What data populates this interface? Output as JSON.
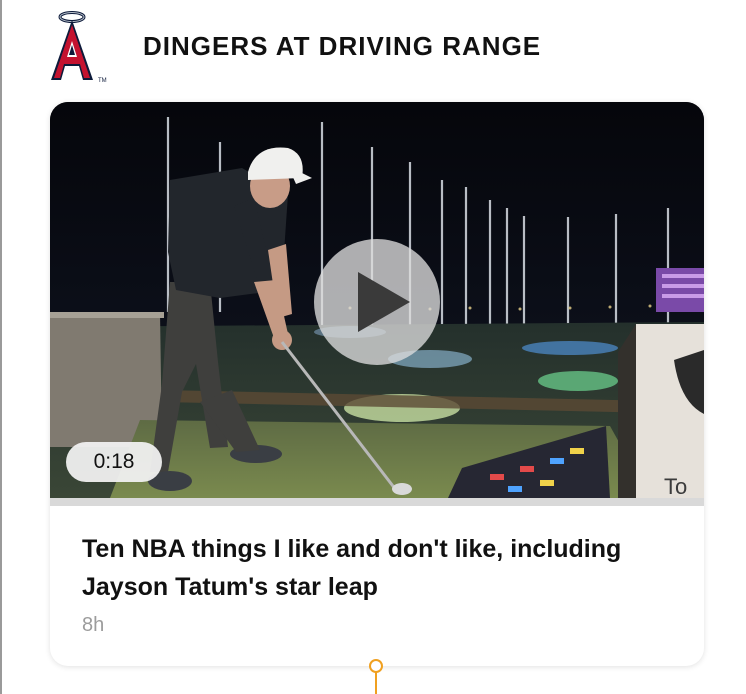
{
  "header": {
    "logo_icon": "angels-logo-icon",
    "title": "DINGERS AT DRIVING RANGE"
  },
  "card": {
    "video": {
      "duration": "0:18",
      "play_icon": "play-icon",
      "progress": 0
    },
    "headline": "Ten NBA things I like and don't like, including Jayson Tatum's star leap",
    "timestamp": "8h"
  },
  "colors": {
    "brand_red": "#c4122f",
    "brand_navy": "#0d1a3a",
    "connector": "#f0a020",
    "timestamp": "#9c9c9c"
  }
}
